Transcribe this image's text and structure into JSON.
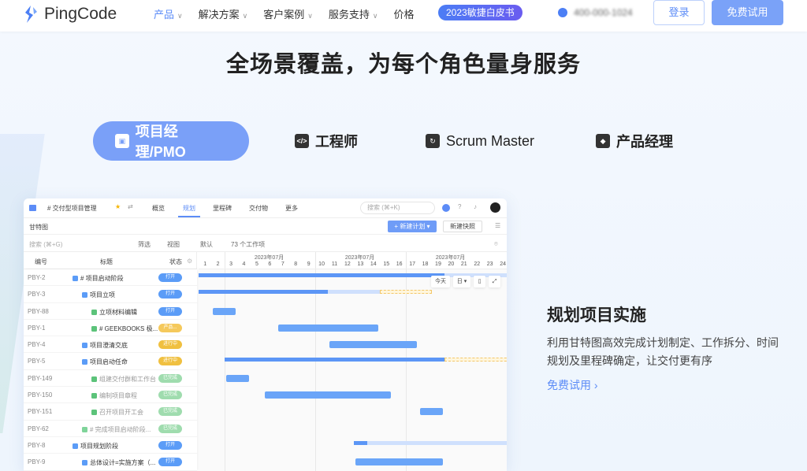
{
  "nav": {
    "brand": "PingCode",
    "items": [
      {
        "label": "产品",
        "dropdown": true,
        "active": true
      },
      {
        "label": "解决方案",
        "dropdown": true
      },
      {
        "label": "客户案例",
        "dropdown": true
      },
      {
        "label": "服务支持",
        "dropdown": true
      },
      {
        "label": "价格",
        "dropdown": false
      }
    ],
    "badge": "2023敏捷白皮书",
    "phone": "400-000-1024",
    "login": "登录",
    "trial": "免费试用"
  },
  "hero": {
    "title": "全场景覆盖，为每个角色量身服务"
  },
  "roles": [
    {
      "label": "项目经理/PMO",
      "icon": "briefcase-icon",
      "active": true
    },
    {
      "label": "工程师",
      "icon": "code-window-icon"
    },
    {
      "label": "Scrum Master",
      "icon": "scrum-cycle-icon"
    },
    {
      "label": "产品经理",
      "icon": "cube-icon"
    }
  ],
  "app": {
    "breadcrumb": "# 交付型项目管理",
    "tabs": [
      "概览",
      "规划",
      "里程碑",
      "交付物",
      "更多"
    ],
    "active_tab": "规划",
    "search_placeholder": "搜索 (⌘+K)",
    "view_title": "甘特图",
    "new_plan": "+ 新建计划 ▾",
    "snapshot": "新建快照",
    "filter_placeholder": "搜索 (⌘+G)",
    "filter": "筛选",
    "view": "视图",
    "default": "默认",
    "count": "73 个工作项",
    "columns": [
      "编号",
      "标题",
      "状态"
    ],
    "months": [
      "2023年07月",
      "2023年07月",
      "2023年07月"
    ],
    "days": [
      1,
      2,
      3,
      4,
      5,
      6,
      7,
      8,
      9,
      10,
      11,
      12,
      13,
      14,
      15,
      16,
      17,
      18,
      19,
      20,
      21,
      22,
      23,
      24
    ],
    "today": "今天",
    "scale": "日 ▾",
    "rows": [
      {
        "id": "PBY-2",
        "title": "# 项目启动阶段",
        "depth": 0,
        "type": "epic",
        "status": "打开",
        "sc": "open",
        "bar": {
          "kind": "summary",
          "start": 1,
          "end": 25,
          "progress": 19
        }
      },
      {
        "id": "PBY-3",
        "title": "项目立项",
        "depth": 1,
        "type": "epic",
        "status": "打开",
        "sc": "open",
        "bar": {
          "kind": "summary",
          "start": 1,
          "end": 14,
          "progress": 10,
          "overdue_end": 18
        }
      },
      {
        "id": "PBY-88",
        "title": "立项材料编辑",
        "depth": 2,
        "type": "task",
        "status": "打开",
        "sc": "open",
        "bar": {
          "kind": "task",
          "start": 2,
          "end": 3,
          "links": 1
        }
      },
      {
        "id": "PBY-1",
        "title": "# GEEKBOOKS 极...",
        "depth": 2,
        "type": "task",
        "status": "产品...",
        "sc": "prod",
        "bar": {
          "kind": "task",
          "start": 7,
          "end": 14,
          "links": 1
        }
      },
      {
        "id": "PBY-4",
        "title": "项目澄清交底",
        "depth": 1,
        "type": "epic",
        "status": "进行中",
        "sc": "prog",
        "bar": {
          "kind": "task",
          "start": 11,
          "end": 17
        }
      },
      {
        "id": "PBY-5",
        "title": "项目启动任命",
        "depth": 1,
        "type": "epic",
        "status": "进行中",
        "sc": "prog",
        "bar": {
          "kind": "summary",
          "start": 3,
          "end": 19,
          "progress": 19,
          "overdue_end": 25
        }
      },
      {
        "id": "PBY-149",
        "title": "组建交付群和工作台",
        "depth": 2,
        "type": "task",
        "status": "已完成",
        "sc": "done",
        "bar": {
          "kind": "task",
          "start": 3,
          "end": 4,
          "links": 1
        }
      },
      {
        "id": "PBY-150",
        "title": "编制项目章程",
        "depth": 2,
        "type": "task",
        "status": "已完成",
        "sc": "done",
        "bar": {
          "kind": "task",
          "start": 6,
          "end": 15,
          "links": 1
        }
      },
      {
        "id": "PBY-151",
        "title": "召开项目开工会",
        "depth": 2,
        "type": "task",
        "status": "已完成",
        "sc": "done",
        "bar": {
          "kind": "task",
          "start": 18,
          "end": 19,
          "links": 1
        }
      },
      {
        "id": "PBY-62",
        "title": "# 完成项目启动阶段...",
        "depth": 1,
        "type": "milestone",
        "status": "已完成",
        "sc": "done"
      },
      {
        "id": "PBY-8",
        "title": "项目规划阶段",
        "depth": 0,
        "type": "epic",
        "status": "打开",
        "sc": "open",
        "bar": {
          "kind": "summary",
          "start": 13,
          "end": 25,
          "progress": 13
        }
      },
      {
        "id": "PBY-9",
        "title": "总体设计=实施方案（...",
        "depth": 1,
        "type": "epic",
        "status": "打开",
        "sc": "open",
        "bar": {
          "kind": "task",
          "start": 13,
          "end": 19
        }
      }
    ]
  },
  "feature": {
    "title": "规划项目实施",
    "desc": "利用甘特图高效完成计划制定、工作拆分、时间规划及里程碑确定，让交付更有序",
    "link": "免费试用 ›"
  },
  "colors": {
    "accent": "#5c8cf7",
    "open": "#5b9cf7",
    "prod": "#f5c95c",
    "prog": "#f0c040",
    "done": "#9fdcae"
  }
}
